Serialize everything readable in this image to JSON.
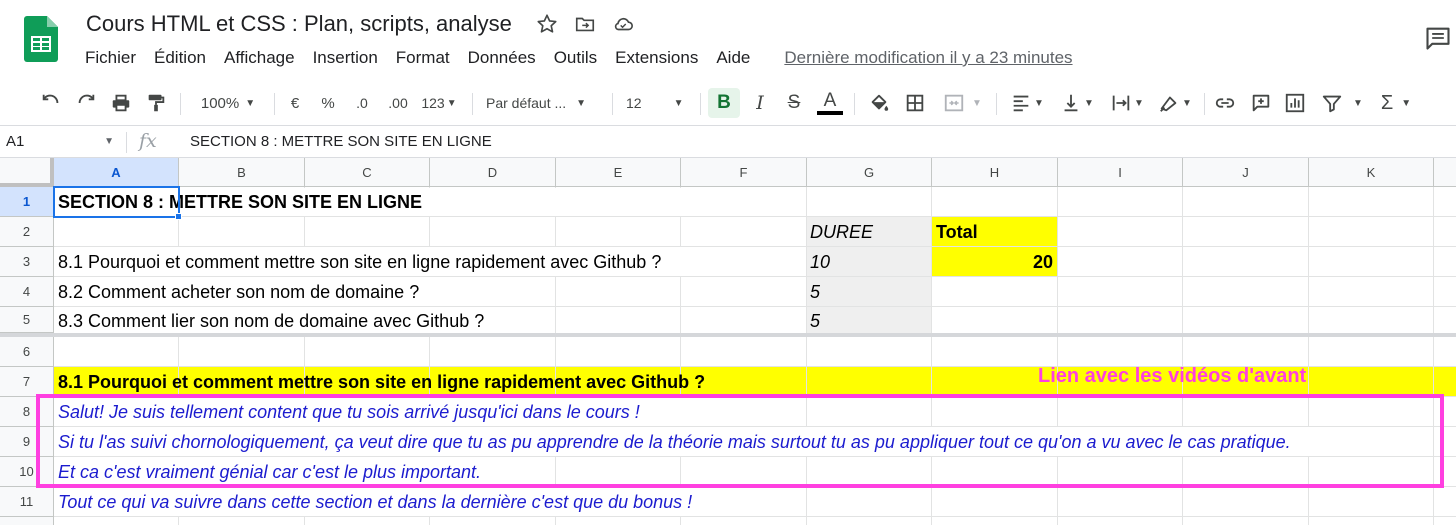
{
  "app": {
    "doc_title": "Cours HTML et CSS : Plan, scripts, analyse",
    "brand_color": "#0f9d58",
    "icons": [
      "star-icon",
      "move-to-folder-icon",
      "cloud-status-icon",
      "comment-history-icon"
    ]
  },
  "menu": {
    "items": [
      "Fichier",
      "Édition",
      "Affichage",
      "Insertion",
      "Format",
      "Données",
      "Outils",
      "Extensions",
      "Aide"
    ],
    "last_modified": "Dernière modification il y a 23 minutes"
  },
  "toolbar": {
    "zoom": "100%",
    "currency": "€",
    "percent": "%",
    "decrease_decimals": ".0",
    "increase_decimals": ".00",
    "number_format": "123",
    "font": "Par défaut ...",
    "font_size": "12",
    "bold": "B",
    "italic": "I",
    "strike": "S",
    "text_color": "A",
    "icons": [
      "undo-icon",
      "redo-icon",
      "print-icon",
      "paint-format-icon",
      "fill-color-icon",
      "borders-icon",
      "merge-icon",
      "align-left-icon",
      "valign-bottom-icon",
      "text-wrap-icon",
      "text-rotate-icon",
      "link-icon",
      "comment-icon",
      "chart-icon",
      "filter-icon",
      "sum-icon"
    ]
  },
  "formula_bar": {
    "cell_ref": "A1",
    "fx": "fx",
    "content": "SECTION 8 : METTRE SON SITE EN LIGNE"
  },
  "columns": [
    "A",
    "B",
    "C",
    "D",
    "E",
    "F",
    "G",
    "H",
    "I",
    "J",
    "K"
  ],
  "rows": [
    "1",
    "2",
    "3",
    "4",
    "5",
    "6",
    "7",
    "8",
    "9",
    "10",
    "11"
  ],
  "cells": {
    "a1": "SECTION 8 : METTRE SON SITE EN LIGNE",
    "g2": "DUREE",
    "h2": "Total",
    "a3": "8.1 Pourquoi et comment mettre son site en ligne rapidement avec Github ?",
    "g3": "10",
    "h3": "20",
    "a4": "8.2 Comment acheter son nom de domaine ?",
    "g4": "5",
    "a5": "8.3 Comment lier son nom de domaine avec Github ?",
    "g5": "5",
    "a7": "8.1 Pourquoi et comment mettre son site en ligne rapidement avec Github ?",
    "a8": "Salut! Je suis tellement content que tu sois arrivé jusqu'ici dans le cours !",
    "a9": "Si tu l'as suivi chornologiquement, ça veut dire que tu as pu apprendre de la théorie mais surtout tu as pu appliquer tout ce qu'on a vu avec le cas pratique.",
    "a10": "Et ca c'est vraiment génial car c'est le plus important.",
    "a11": "Tout ce qui va suivre dans cette section et dans la dernière c'est que du bonus !"
  },
  "annotation": {
    "text": "Lien avec les vidéos d'avant",
    "color": "#ff3fe0"
  },
  "colors": {
    "highlight_yellow": "#ffff00",
    "duration_gray": "#efefef",
    "speech_blue": "#1c1ccf",
    "selection_blue": "#1a73e8"
  }
}
